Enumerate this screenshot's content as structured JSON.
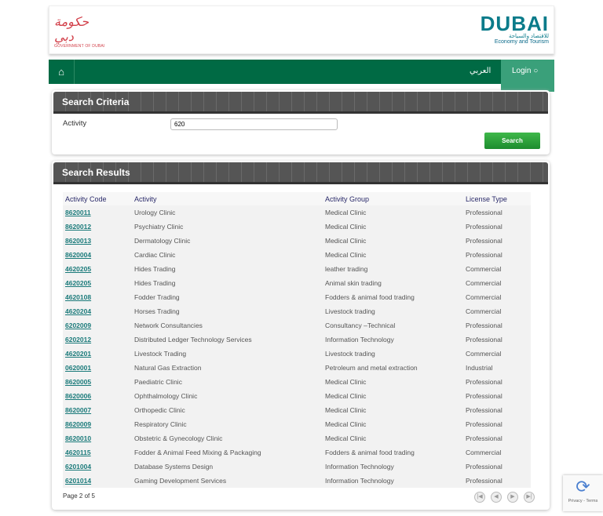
{
  "header": {
    "gov_logo_ar": "حكومة دبي",
    "gov_logo_en": "GOVERNMENT OF DUBAI",
    "dubai_logo": "DUBAI",
    "dubai_ar": "للاقتصاد والسياحة",
    "dubai_en": "Economy and Tourism"
  },
  "nav": {
    "home_icon": "home-icon",
    "arabic": "العربي",
    "login": "Login",
    "login_icon": "user-icon"
  },
  "search": {
    "title": "Search Criteria",
    "activity_label": "Activity",
    "activity_value": "620",
    "button": "Search"
  },
  "results": {
    "title": "Search Results",
    "columns": [
      "Activity Code",
      "Activity",
      "Activity Group",
      "License Type"
    ],
    "rows": [
      [
        "8620011",
        "Urology Clinic",
        "Medical Clinic",
        "Professional"
      ],
      [
        "8620012",
        "Psychiatry Clinic",
        "Medical Clinic",
        "Professional"
      ],
      [
        "8620013",
        "Dermatology Clinic",
        "Medical Clinic",
        "Professional"
      ],
      [
        "8620004",
        "Cardiac Clinic",
        "Medical Clinic",
        "Professional"
      ],
      [
        "4620205",
        "Hides Trading",
        "leather trading",
        "Commercial"
      ],
      [
        "4620205",
        "Hides Trading",
        "Animal skin trading",
        "Commercial"
      ],
      [
        "4620108",
        "Fodder Trading",
        "Fodders & animal food trading",
        "Commercial"
      ],
      [
        "4620204",
        "Horses Trading",
        "Livestock trading",
        "Commercial"
      ],
      [
        "6202009",
        "Network Consultancies",
        "Consultancy –Technical",
        "Professional"
      ],
      [
        "6202012",
        "Distributed Ledger Technology Services",
        "Information Technology",
        "Professional"
      ],
      [
        "4620201",
        "Livestock Trading",
        "Livestock trading",
        "Commercial"
      ],
      [
        "0620001",
        "Natural Gas Extraction",
        "Petroleum and metal extraction",
        "Industrial"
      ],
      [
        "8620005",
        "Paediatric Clinic",
        "Medical Clinic",
        "Professional"
      ],
      [
        "8620006",
        "Ophthalmology Clinic",
        "Medical Clinic",
        "Professional"
      ],
      [
        "8620007",
        "Orthopedic Clinic",
        "Medical Clinic",
        "Professional"
      ],
      [
        "8620009",
        "Respiratory Clinic",
        "Medical Clinic",
        "Professional"
      ],
      [
        "8620010",
        "Obstetric & Gynecology Clinic",
        "Medical Clinic",
        "Professional"
      ],
      [
        "4620115",
        "Fodder & Animal Feed Mixing & Packaging",
        "Fodders & animal food trading",
        "Commercial"
      ],
      [
        "6201004",
        "Database Systems Design",
        "Information Technology",
        "Professional"
      ],
      [
        "6201014",
        "Gaming Development Services",
        "Information Technology",
        "Professional"
      ]
    ],
    "page_info": "Page 2 of 5"
  },
  "recaptcha": {
    "links": "Privacy - Terms"
  }
}
